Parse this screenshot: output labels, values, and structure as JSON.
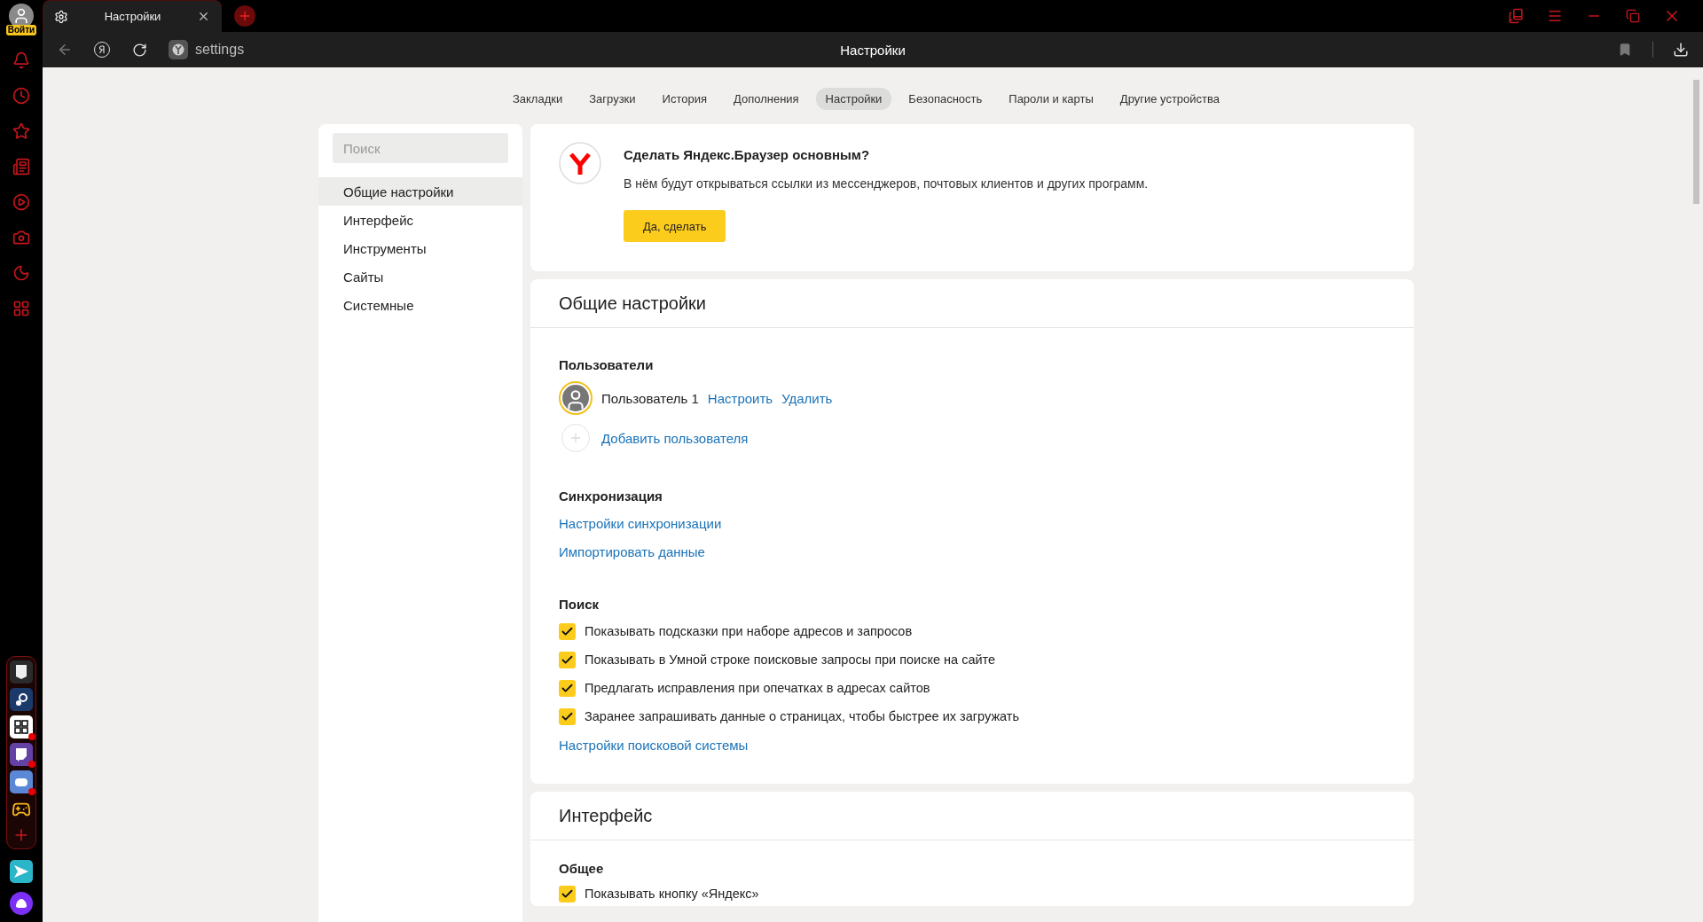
{
  "window": {
    "tab_title": "Настройки",
    "address": "settings",
    "page_title": "Настройки"
  },
  "profile": {
    "login": "Войти"
  },
  "dock": [
    {
      "kind": "epic",
      "badge": false
    },
    {
      "kind": "steam",
      "badge": false
    },
    {
      "kind": "gog",
      "badge": true
    },
    {
      "kind": "twitch",
      "badge": true
    },
    {
      "kind": "discord",
      "badge": true
    },
    {
      "kind": "gamepad",
      "badge": false
    }
  ],
  "nav": [
    {
      "label": "Закладки",
      "selected": false
    },
    {
      "label": "Загрузки",
      "selected": false
    },
    {
      "label": "История",
      "selected": false
    },
    {
      "label": "Дополнения",
      "selected": false
    },
    {
      "label": "Настройки",
      "selected": true
    },
    {
      "label": "Безопасность",
      "selected": false
    },
    {
      "label": "Пароли и карты",
      "selected": false
    },
    {
      "label": "Другие устройства",
      "selected": false
    }
  ],
  "sidebar": {
    "search": {
      "placeholder": "Поиск"
    },
    "items": [
      {
        "label": "Общие настройки",
        "selected": true
      },
      {
        "label": "Интерфейс",
        "selected": false
      },
      {
        "label": "Инструменты",
        "selected": false
      },
      {
        "label": "Сайты",
        "selected": false
      },
      {
        "label": "Системные",
        "selected": false
      }
    ]
  },
  "promo": {
    "title": "Сделать Яндекс.Браузер основным?",
    "text": "В нём будут открываться ссылки из мессенджеров, почтовых клиентов и других программ.",
    "button": "Да, сделать"
  },
  "sections": [
    {
      "title": "Общие настройки",
      "groups": [
        {
          "kind": "users",
          "heading": "Пользователи",
          "users": [
            {
              "name": "Пользователь 1",
              "actions": [
                "Настроить",
                "Удалить"
              ]
            }
          ],
          "add": "Добавить пользователя"
        },
        {
          "kind": "links",
          "heading": "Синхронизация",
          "links": [
            "Настройки синхронизации",
            "Импортировать данные"
          ]
        },
        {
          "kind": "checks",
          "heading": "Поиск",
          "checks": [
            {
              "label": "Показывать подсказки при наборе адресов и запросов",
              "checked": true
            },
            {
              "label": "Показывать в Умной строке поисковые запросы при поиске на сайте",
              "checked": true
            },
            {
              "label": "Предлагать исправления при опечатках в адресах сайтов",
              "checked": true
            },
            {
              "label": "Заранее запрашивать данные о страницах, чтобы быстрее их загружать",
              "checked": true
            }
          ],
          "link": "Настройки поисковой системы"
        }
      ]
    },
    {
      "title": "Интерфейс",
      "groups": [
        {
          "kind": "checks",
          "heading": "Общее",
          "checks": [
            {
              "label": "Показывать кнопку «Яндекс»",
              "checked": true
            }
          ]
        }
      ]
    }
  ]
}
